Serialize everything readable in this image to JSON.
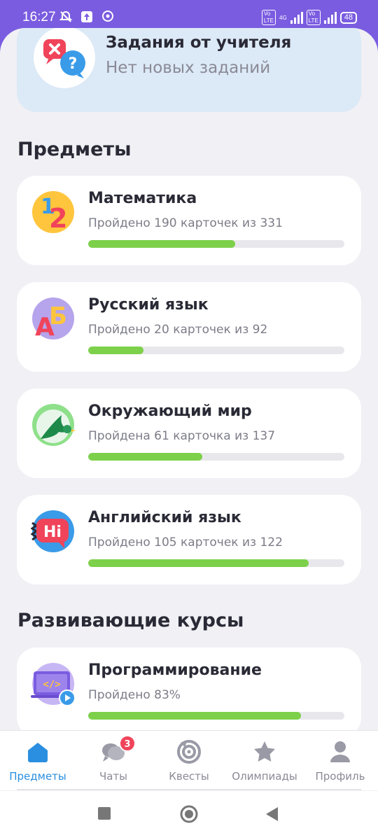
{
  "status_bar": {
    "time": "16:27",
    "network": "4G",
    "battery": "48"
  },
  "teacher": {
    "title": "Задания от учителя",
    "subtitle": "Нет новых заданий"
  },
  "sections": {
    "subjects": "Предметы",
    "courses": "Развивающие курсы"
  },
  "subjects": [
    {
      "title": "Математика",
      "progress_text": "Пройдено 190 карточек из 331",
      "progress": 0.574
    },
    {
      "title": "Русский язык",
      "progress_text": "Пройдено 20 карточек из 92",
      "progress": 0.217
    },
    {
      "title": "Окружающий мир",
      "progress_text": "Пройдена 61 карточка из 137",
      "progress": 0.445
    },
    {
      "title": "Английский язык",
      "progress_text": "Пройдено 105 карточек из 122",
      "progress": 0.861
    }
  ],
  "courses": [
    {
      "title": "Программирование",
      "progress_text": "Пройдено 83%",
      "progress": 0.83
    }
  ],
  "nav": {
    "items": [
      {
        "label": "Предметы",
        "icon": "home-icon",
        "active": true
      },
      {
        "label": "Чаты",
        "icon": "chat-icon",
        "badge": "3"
      },
      {
        "label": "Квесты",
        "icon": "target-icon"
      },
      {
        "label": "Олимпиады",
        "icon": "star-icon"
      },
      {
        "label": "Профиль",
        "icon": "profile-icon"
      }
    ]
  },
  "colors": {
    "accent": "#7a5ce0",
    "progress": "#7dd04a",
    "active_nav": "#2a8fe0",
    "badge": "#f0445a"
  }
}
